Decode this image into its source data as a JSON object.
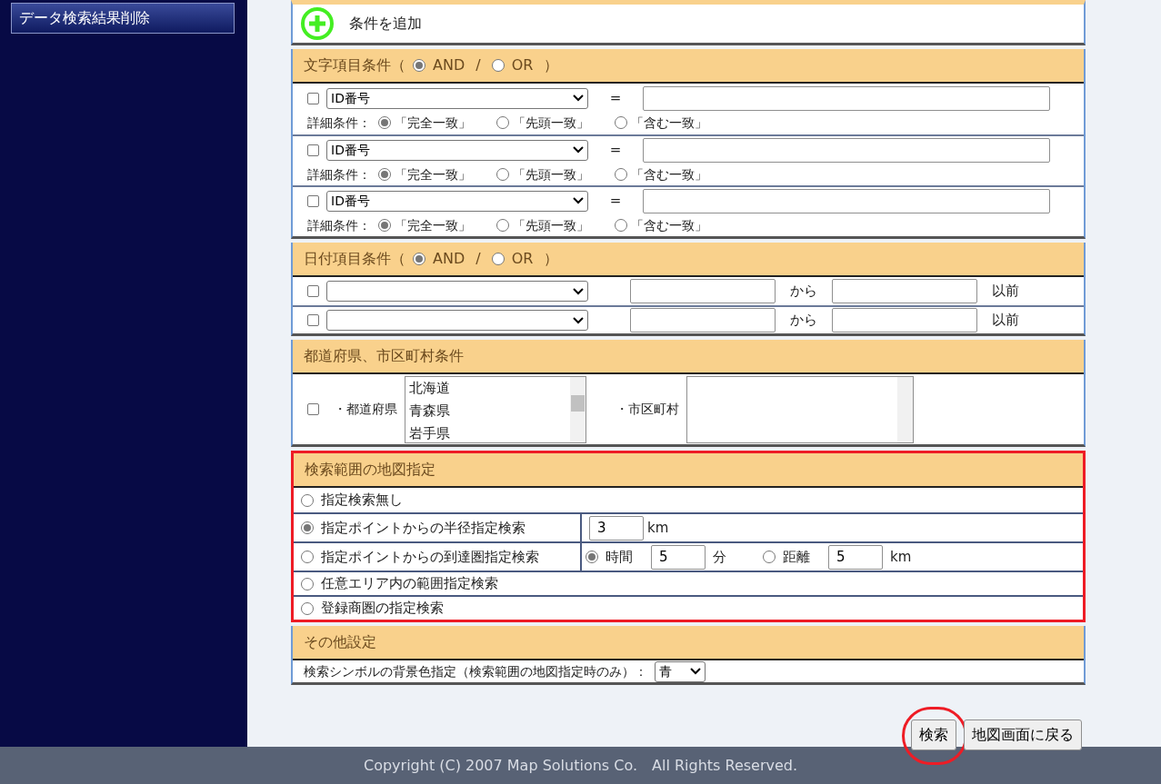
{
  "sidebar": {
    "buttons": [
      "データ検索結果削除"
    ]
  },
  "add_condition": {
    "label": "条件を追加"
  },
  "text_conditions": {
    "title": "文字項目条件（",
    "logic": [
      {
        "label": "AND",
        "selected": true
      },
      {
        "label": "OR",
        "selected": false
      }
    ],
    "separator": "/",
    "close": "）",
    "rows": [
      {
        "checked": false,
        "field": "ID番号",
        "operator": "=",
        "detail_label": "詳細条件：",
        "match_options": [
          {
            "label": "「完全一致」",
            "selected": true
          },
          {
            "label": "「先頭一致」",
            "selected": false
          },
          {
            "label": "「含む一致」",
            "selected": false
          }
        ]
      },
      {
        "checked": false,
        "field": "ID番号",
        "operator": "=",
        "detail_label": "詳細条件：",
        "match_options": [
          {
            "label": "「完全一致」",
            "selected": true
          },
          {
            "label": "「先頭一致」",
            "selected": false
          },
          {
            "label": "「含む一致」",
            "selected": false
          }
        ]
      },
      {
        "checked": false,
        "field": "ID番号",
        "operator": "=",
        "detail_label": "詳細条件：",
        "match_options": [
          {
            "label": "「完全一致」",
            "selected": true
          },
          {
            "label": "「先頭一致」",
            "selected": false
          },
          {
            "label": "「含む一致」",
            "selected": false
          }
        ]
      }
    ]
  },
  "date_conditions": {
    "title": "日付項目条件（",
    "logic": [
      {
        "label": "AND",
        "selected": true
      },
      {
        "label": "OR",
        "selected": false
      }
    ],
    "separator": "/",
    "close": "）",
    "rows": [
      {
        "checked": false,
        "from_label": "から",
        "until_label": "以前"
      },
      {
        "checked": false,
        "from_label": "から",
        "until_label": "以前"
      }
    ]
  },
  "region_conditions": {
    "title": "都道府県、市区町村条件",
    "checked": false,
    "prefecture_label": "・都道府県",
    "prefectures": [
      "北海道",
      "青森県",
      "岩手県"
    ],
    "city_label": "・市区町村"
  },
  "map_range": {
    "title": "検索範囲の地図指定",
    "highlighted": true,
    "options": [
      {
        "kind": "plain",
        "label": "指定検索無し",
        "selected": false
      },
      {
        "kind": "radius",
        "label": "指定ポイントからの半径指定検索",
        "selected": true,
        "value": "3",
        "unit": "km"
      },
      {
        "kind": "reach",
        "label": "指定ポイントからの到達圏指定検索",
        "selected": false,
        "modes": [
          {
            "label": "時間",
            "selected": true,
            "value": "5",
            "unit": "分"
          },
          {
            "label": "距離",
            "selected": false,
            "value": "5",
            "unit": "km"
          }
        ]
      },
      {
        "kind": "plain",
        "label": "任意エリア内の範囲指定検索",
        "selected": false
      },
      {
        "kind": "plain",
        "label": "登録商圏の指定検索",
        "selected": false
      }
    ]
  },
  "other_settings": {
    "title": "その他設定",
    "symbol_color_label": "検索シンボルの背景色指定（検索範囲の地図指定時のみ）：",
    "symbol_color": "青"
  },
  "buttons": [
    {
      "label": "検索",
      "circled": true
    },
    {
      "label": "地図画面に戻る",
      "circled": false
    }
  ],
  "footer": "Copyright (C) 2007 Map Solutions Co.　All Rights Reserved."
}
